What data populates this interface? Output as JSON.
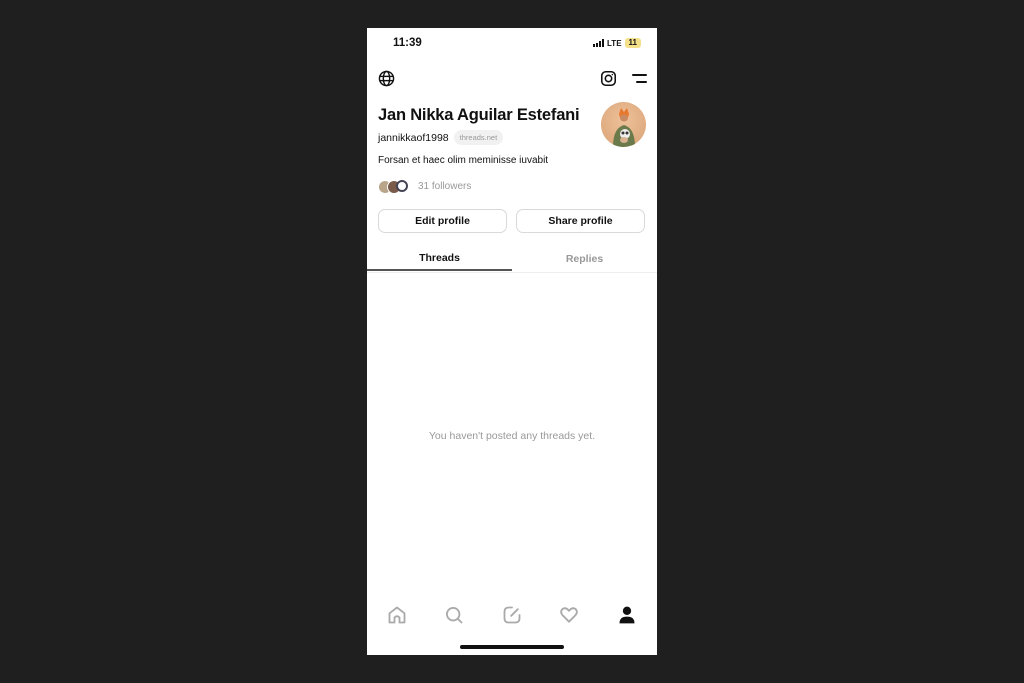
{
  "status_bar": {
    "time": "11:39",
    "network": "LTE",
    "battery": "11"
  },
  "header": {
    "left_icon": "globe-icon",
    "right_icons": [
      "instagram-icon",
      "menu-icon"
    ]
  },
  "profile": {
    "name": "Jan Nikka Aguilar Estefani",
    "handle": "jannikkaof1998",
    "domain_badge": "threads.net",
    "bio": "Forsan et haec olim meminisse iuvabit",
    "followers_text": "31 followers",
    "avatar_icon": "profile-photo"
  },
  "buttons": {
    "edit_profile": "Edit profile",
    "share_profile": "Share profile"
  },
  "tabs": [
    {
      "label": "Threads",
      "active": true
    },
    {
      "label": "Replies",
      "active": false
    }
  ],
  "empty_state": "You haven't posted any threads yet.",
  "bottom_nav": [
    {
      "icon": "home-icon",
      "active": false
    },
    {
      "icon": "search-icon",
      "active": false
    },
    {
      "icon": "compose-icon",
      "active": false
    },
    {
      "icon": "heart-icon",
      "active": false
    },
    {
      "icon": "profile-icon",
      "active": true
    }
  ],
  "colors": {
    "background": "#1f1f1f",
    "screen": "#ffffff",
    "text_primary": "#111111",
    "text_secondary": "#999999",
    "battery": "#f5e08a"
  }
}
